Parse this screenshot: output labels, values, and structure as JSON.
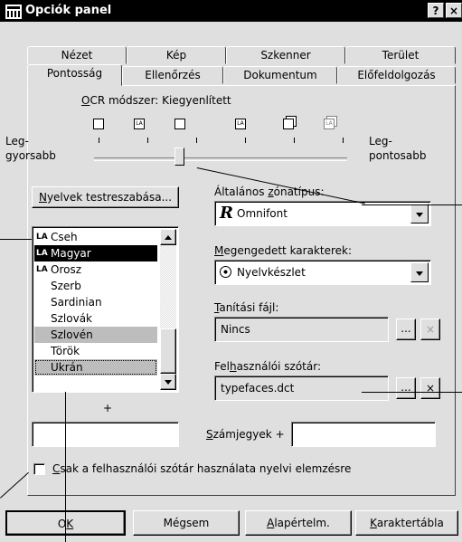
{
  "window": {
    "title": "Opciók panel",
    "help_button": "?",
    "close_button": "×"
  },
  "tabs": {
    "row1": [
      "Nézet",
      "Kép",
      "Szkenner",
      "Terület"
    ],
    "row2": [
      "Pontosság",
      "Ellenőrzés",
      "Dokumentum",
      "Előfeldolgozás"
    ],
    "active": "Pontosság"
  },
  "ocr": {
    "label_underlined": "O",
    "label_rest": "CR módszer: Kiegyenlített",
    "left_label_line1": "Leg-",
    "left_label_line2": "gyorsabb",
    "right_label_line1": "Leg-",
    "right_label_line2": "pontosabb",
    "slider_position": 0.33,
    "icons": [
      "blank-square-icon",
      "la-page-icon",
      "page-icon",
      "la-page-icon",
      "stacked-pages-icon",
      "stacked-la-pages-icon"
    ]
  },
  "languages": {
    "customize_button_underlined": "N",
    "customize_button_rest": "yelvek testreszabása...",
    "items": [
      "Cseh",
      "Magyar",
      "Orosz",
      "Szerb",
      "Sardinian",
      "Szlovák",
      "Szlovén",
      "Török",
      "Ukrán"
    ],
    "selected": "Magyar",
    "plus_label": "+"
  },
  "zone_type": {
    "label_pre": "Általános ",
    "label_underlined": "z",
    "label_rest": "ónatípus:",
    "value": "Omnifont",
    "icon_glyph": "R"
  },
  "allowed_chars": {
    "label_underlined": "M",
    "label_rest": "egengedett karakterek:",
    "value": "Nyelvkészlet"
  },
  "training_file": {
    "label_underlined": "T",
    "label_rest": "anítási fájl:",
    "value": "Nincs",
    "browse": "...",
    "clear": "×"
  },
  "user_dictionary": {
    "label_pre": "Fel",
    "label_underlined": "h",
    "label_rest": "asználói szótár:",
    "value": "typefaces.dct",
    "browse": "...",
    "clear": "×"
  },
  "digits": {
    "label_underlined": "S",
    "label_rest": "zámjegyek",
    "plus": "+"
  },
  "dictionary_checkbox": {
    "label_underlined": "C",
    "label_rest": "sak a felhasználói szótár használata nyelvi elemzésre"
  },
  "buttons": {
    "ok_pre": "O",
    "ok_underlined": "K",
    "cancel": "Mégsem",
    "defaults_underlined": "A",
    "defaults_rest": "lapértelm.",
    "chartable_underlined": "K",
    "chartable_rest": "araktertábla"
  }
}
